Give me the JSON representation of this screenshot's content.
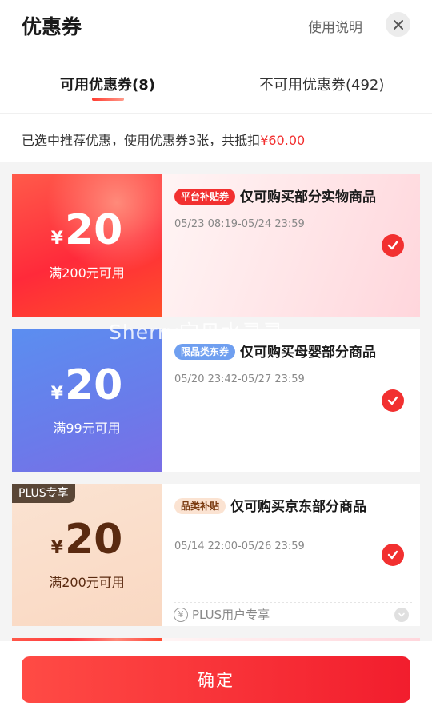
{
  "header": {
    "title": "优惠券",
    "help_label": "使用说明"
  },
  "tabs": [
    {
      "label": "可用优惠券(8)",
      "active": true
    },
    {
      "label": "不可用优惠券(492)",
      "active": false
    }
  ],
  "summary": {
    "text": "已选中推荐优惠，使用优惠券3张，共抵扣",
    "amount": "¥60.00"
  },
  "coupons": [
    {
      "yen": "¥",
      "value": "20",
      "condition": "满200元可用",
      "tag": "平台补贴券",
      "title": "仅可购买部分实物商品",
      "date": "05/23 08:19-05/24 23:59",
      "selected": true
    },
    {
      "yen": "¥",
      "value": "20",
      "condition": "满99元可用",
      "tag": "限品类东券",
      "title": "仅可购买母婴部分商品",
      "date": "05/20 23:42-05/27 23:59",
      "selected": true
    },
    {
      "badge": "PLUS专享",
      "yen": "¥",
      "value": "20",
      "condition": "满200元可用",
      "tag": "品类补贴",
      "title": "仅可购买京东部分商品",
      "date": "05/14 22:00-05/26 23:59",
      "selected": true,
      "footer_note": "PLUS用户专享"
    }
  ],
  "watermark": "Sherry宝贝水灵灵",
  "footer": {
    "confirm_label": "确定"
  },
  "colors": {
    "accent": "#f23030",
    "plus_badge": "#5a4636"
  }
}
